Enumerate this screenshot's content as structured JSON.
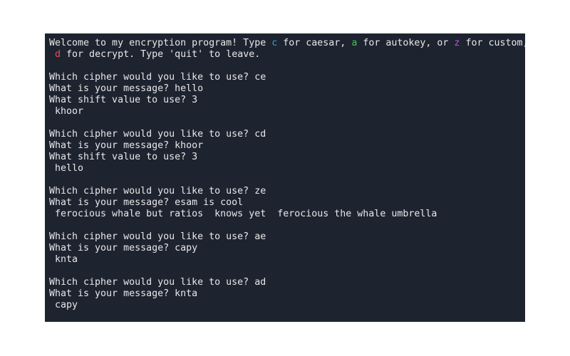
{
  "colors": {
    "background": "#1e2330",
    "text": "#e8e8e8",
    "caesar_key": "#2aa6c9",
    "autokey_key": "#4bbf5a",
    "custom_key": "#c24fd0",
    "decrypt_key": "#e0525a"
  },
  "welcome": {
    "p1": "Welcome to my encryption program! Type ",
    "c_key": "c",
    "p2": " for caesar, ",
    "a_key": "a",
    "p3": " for autokey, or ",
    "z_key": "z",
    "p4": " for custom,",
    "line2_prefix": " ",
    "d_key": "d",
    "line2_rest": " for decrypt. Type 'quit' to leave."
  },
  "sessions": [
    {
      "cipher_prompt": "Which cipher would you like to use? ce",
      "message_prompt": "What is your message? hello",
      "shift_prompt": "What shift value to use? 3",
      "output": " khoor"
    },
    {
      "cipher_prompt": "Which cipher would you like to use? cd",
      "message_prompt": "What is your message? khoor",
      "shift_prompt": "What shift value to use? 3",
      "output": " hello"
    },
    {
      "cipher_prompt": "Which cipher would you like to use? ze",
      "message_prompt": "What is your message? esam is cool",
      "output": " ferocious whale but ratios  knows yet  ferocious the whale umbrella"
    },
    {
      "cipher_prompt": "Which cipher would you like to use? ae",
      "message_prompt": "What is your message? capy",
      "output": " knta"
    },
    {
      "cipher_prompt": "Which cipher would you like to use? ad",
      "message_prompt": "What is your message? knta",
      "output": " capy"
    }
  ]
}
